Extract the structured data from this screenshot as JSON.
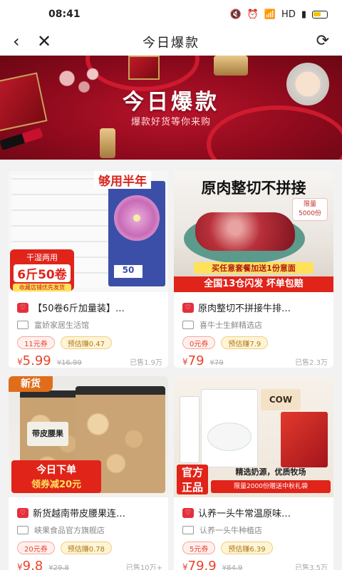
{
  "status": {
    "time": "08:41",
    "network": "HD"
  },
  "nav": {
    "back": "‹",
    "close": "✕",
    "title": "今日爆款",
    "refresh": "⟳"
  },
  "banner": {
    "title": "今日爆款",
    "subtitle": "爆款好货等你来购"
  },
  "products": [
    {
      "title": "【50卷6斤加量装】…",
      "store": "富娇家居生活馆",
      "coupon": "11元券",
      "earn": "预估赚0.47",
      "price_int": "5.99",
      "orig": "¥16.99",
      "sold": "已售1.9万",
      "img": {
        "top": "够用半年",
        "badge1": "干湿两用",
        "badge2": "6斤50卷",
        "badge3": "收藏店铺优先发货",
        "pack": "50"
      }
    },
    {
      "title": "原肉整切不拼接牛排…",
      "store": "喜牛士生鲜精选店",
      "coupon": "0元券",
      "earn": "预估赚7.9",
      "price_int": "79",
      "orig": "¥79",
      "sold": "已售2.3万",
      "img": {
        "top": "原肉整切不拼接",
        "limit1": "限量",
        "limit2": "5000份",
        "promo": "买任意套餐加送1份意面",
        "bottom": "全国13仓闪发 坏单包赔"
      }
    },
    {
      "title": "新货越南带皮腰果连…",
      "store": "峡果食品官方旗舰店",
      "coupon": "20元券",
      "earn": "预估赚0.78",
      "price_int": "9.8",
      "orig": "¥29.8",
      "sold": "已售10万+",
      "img": {
        "corner": "新货",
        "label": "带皮腰果",
        "promo1": "今日下单",
        "promo2": "领券减20元"
      }
    },
    {
      "title": "认养一头牛常温原味…",
      "store": "认养一头牛种植店",
      "coupon": "5元券",
      "earn": "预估赚6.39",
      "price_int": "79.9",
      "orig": "¥84.9",
      "sold": "已售3.5万",
      "img": {
        "brand": "COW",
        "official1": "官方",
        "official2": "正品",
        "promo1": "精选奶源，优质牧场",
        "promo2": "限量2000份赠送中秋礼袋"
      }
    }
  ]
}
